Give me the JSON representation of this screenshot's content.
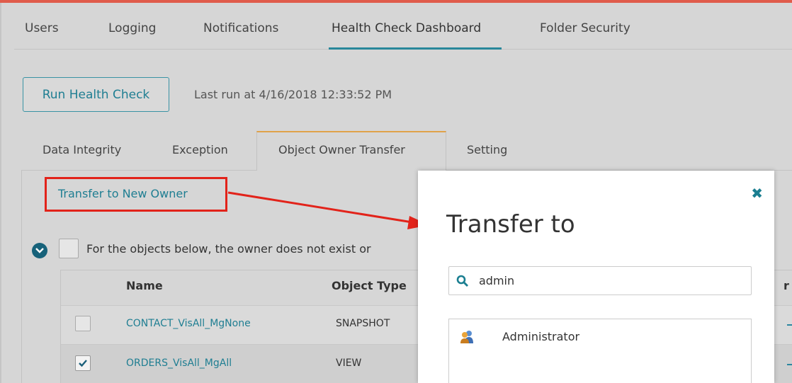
{
  "nav": {
    "items": [
      {
        "label": "Users"
      },
      {
        "label": "Logging"
      },
      {
        "label": "Notifications"
      },
      {
        "label": "Health Check Dashboard"
      },
      {
        "label": "Folder Security"
      }
    ],
    "active_index": 3
  },
  "run": {
    "button_label": "Run Health Check",
    "last_run": "Last run at 4/16/2018 12:33:52 PM"
  },
  "subtabs": {
    "items": [
      {
        "label": "Data Integrity"
      },
      {
        "label": "Exception"
      },
      {
        "label": "Object Owner Transfer"
      },
      {
        "label": "Setting"
      }
    ],
    "active_index": 2
  },
  "transfer": {
    "link_label": "Transfer to New Owner"
  },
  "objects": {
    "description": "For the objects below, the owner does not exist or"
  },
  "table": {
    "columns": [
      "Name",
      "Object Type"
    ],
    "clipped_column_fragment": "r",
    "rows": [
      {
        "name": "CONTACT_VisAll_MgNone",
        "type": "SNAPSHOT",
        "checked": false
      },
      {
        "name": "ORDERS_VisAll_MgAll",
        "type": "VIEW",
        "checked": true
      }
    ]
  },
  "modal": {
    "title": "Transfer to",
    "close_icon": "close-icon",
    "search_value": "admin",
    "results": [
      {
        "label": "Administrator",
        "icon": "user-icon"
      }
    ]
  },
  "colors": {
    "accent": "#28879a",
    "tab_accent": "#e0a24a",
    "highlight": "#e2231a",
    "top_bar": "#e05c4b"
  }
}
